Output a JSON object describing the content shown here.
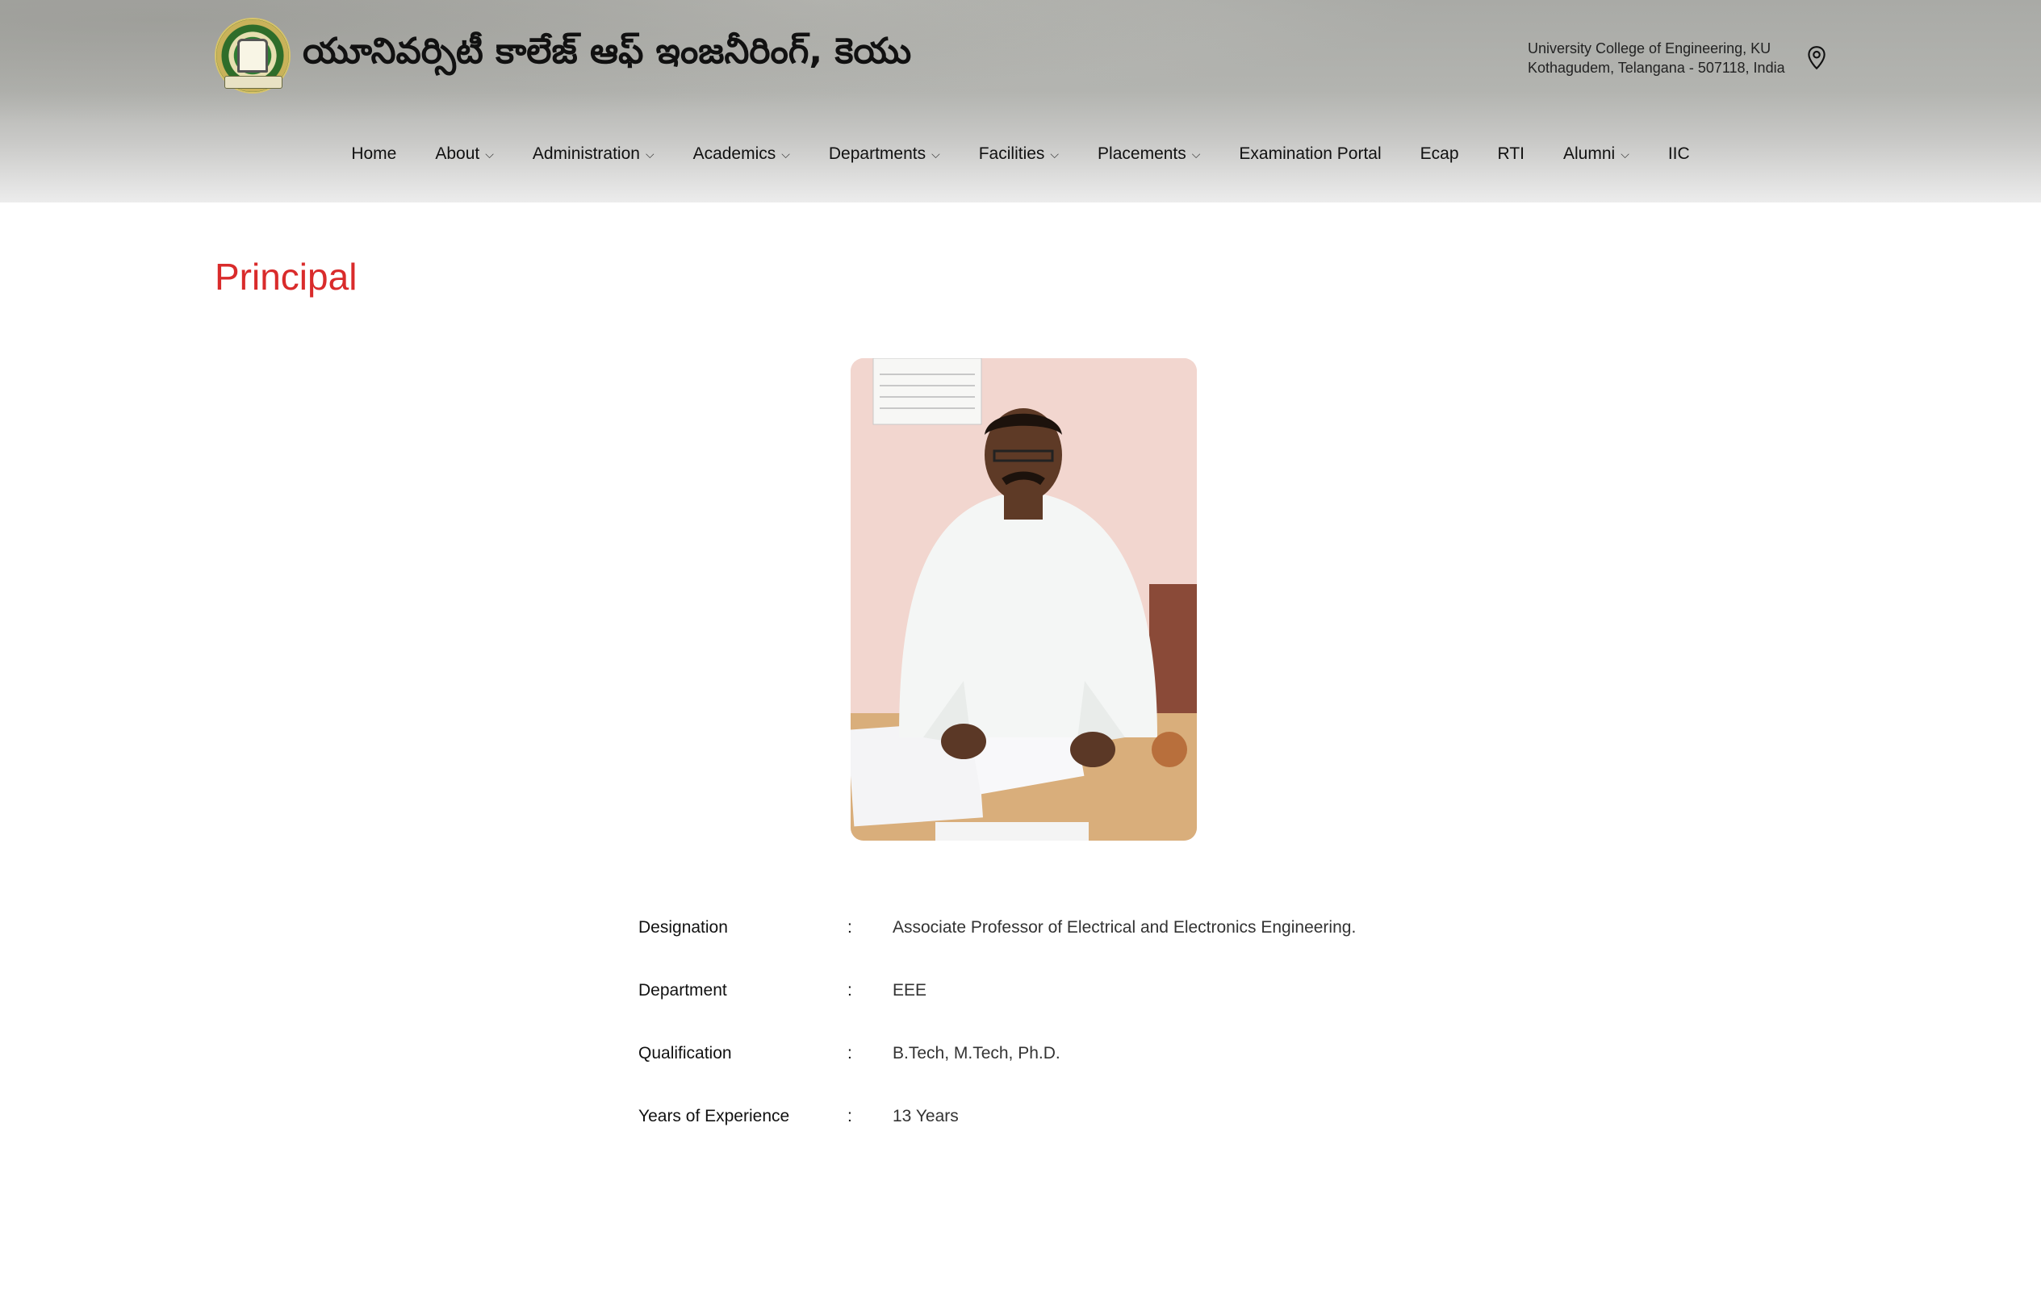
{
  "header": {
    "site_title": "యూనివర్సిటీ కాలేజ్ ఆఫ్ ఇంజనీరింగ్, కెయు",
    "address_line1": "University College of Engineering, KU",
    "address_line2": "Kothagudem, Telangana - 507118, India"
  },
  "nav": [
    {
      "label": "Home",
      "dropdown": false
    },
    {
      "label": "About",
      "dropdown": true
    },
    {
      "label": "Administration",
      "dropdown": true
    },
    {
      "label": "Academics",
      "dropdown": true
    },
    {
      "label": "Departments",
      "dropdown": true
    },
    {
      "label": "Facilities",
      "dropdown": true
    },
    {
      "label": "Placements",
      "dropdown": true
    },
    {
      "label": "Examination Portal",
      "dropdown": false
    },
    {
      "label": "Ecap",
      "dropdown": false
    },
    {
      "label": "RTI",
      "dropdown": false
    },
    {
      "label": "Alumni",
      "dropdown": true
    },
    {
      "label": "IIC",
      "dropdown": false
    }
  ],
  "page": {
    "title": "Principal"
  },
  "details": [
    {
      "label": "Designation",
      "sep": ":",
      "value": "Associate Professor of Electrical and Electronics Engineering."
    },
    {
      "label": "Department",
      "sep": ":",
      "value": "EEE"
    },
    {
      "label": "Qualification",
      "sep": ":",
      "value": "B.Tech, M.Tech, Ph.D."
    },
    {
      "label": "Years of Experience",
      "sep": ":",
      "value": "13 Years"
    }
  ],
  "colors": {
    "title_red": "#d92b2b"
  }
}
